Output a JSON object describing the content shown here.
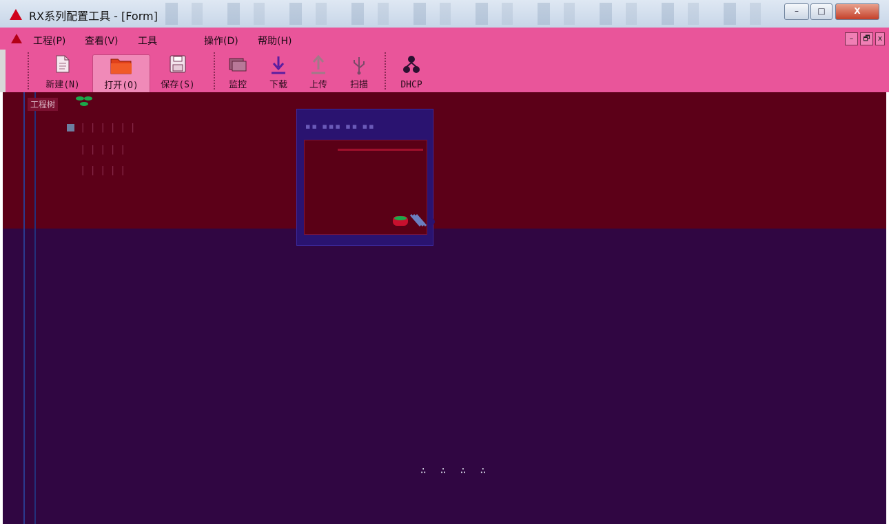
{
  "window": {
    "title": "RX系列配置工具 - [Form]",
    "controls": {
      "minimize": "–",
      "maximize": "□",
      "close": "X"
    }
  },
  "menubar": {
    "items": [
      {
        "key": "project",
        "label": "工程(P)"
      },
      {
        "key": "view",
        "label": "查看(V)"
      },
      {
        "key": "tools",
        "label": "工具"
      },
      {
        "key": "operate",
        "label": "操作(D)"
      },
      {
        "key": "help",
        "label": "帮助(H)"
      }
    ],
    "mdi_controls": {
      "minimize": "–",
      "restore": "🗗",
      "close": "x"
    }
  },
  "toolbar": {
    "buttons": [
      {
        "key": "new",
        "label": "新建(N)",
        "icon": "new-file-icon"
      },
      {
        "key": "open",
        "label": "打开(O)",
        "icon": "folder-open-icon"
      },
      {
        "key": "save",
        "label": "保存(S)",
        "icon": "save-icon"
      },
      {
        "key": "monitor",
        "label": "监控",
        "icon": "monitor-icon"
      },
      {
        "key": "download",
        "label": "下载",
        "icon": "download-arrow-icon"
      },
      {
        "key": "upload",
        "label": "上传",
        "icon": "upload-arrow-icon"
      },
      {
        "key": "scan",
        "label": "扫描",
        "icon": "usb-icon"
      },
      {
        "key": "dhcp",
        "label": "DHCP",
        "icon": "network-icon"
      }
    ]
  },
  "project_panel": {
    "tab_label": "工程树"
  },
  "colors": {
    "menubar_bg": "#e9559a",
    "upper_panel_bg": "#5c0018",
    "lower_panel_bg": "#300642",
    "dialog_bg": "#2a1370"
  }
}
